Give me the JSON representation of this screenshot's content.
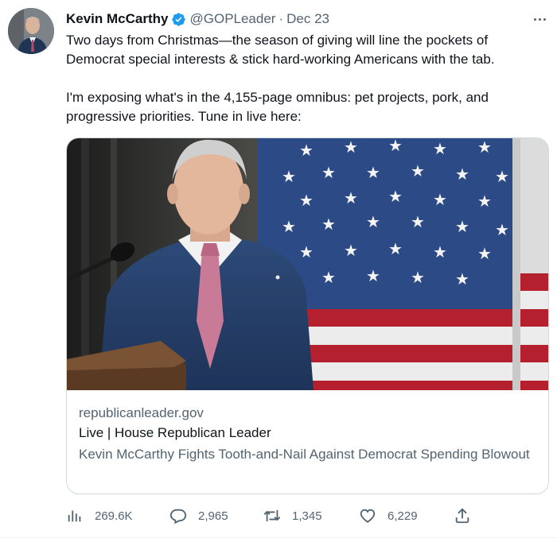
{
  "tweet": {
    "author_name": "Kevin McCarthy",
    "handle": "@GOPLeader",
    "separator": "·",
    "date": "Dec 23",
    "text_paragraphs": [
      "Two days from Christmas—the season of giving will line the pockets of Democrat special interests & stick hard-working Americans with the tab.",
      "I'm exposing what's in the 4,155-page omnibus: pet projects, pork, and progressive priorities. Tune in live here:"
    ]
  },
  "card": {
    "domain": "republicanleader.gov",
    "title": "Live | House Republican Leader",
    "description": "Kevin McCarthy Fights Tooth-and-Nail Against Democrat Spending Blowout"
  },
  "actions": {
    "views": "269.6K",
    "replies": "2,965",
    "retweets": "1,345",
    "likes": "6,229"
  },
  "icons": {
    "verified": "verified-badge-icon",
    "more": "more-options-icon",
    "views": "analytics-icon",
    "reply": "reply-icon",
    "retweet": "retweet-icon",
    "like": "heart-icon",
    "share": "share-icon"
  },
  "colors": {
    "text_primary": "#0f1419",
    "text_secondary": "#536471",
    "verified_blue": "#1d9bf0",
    "border": "#cfd9de"
  }
}
